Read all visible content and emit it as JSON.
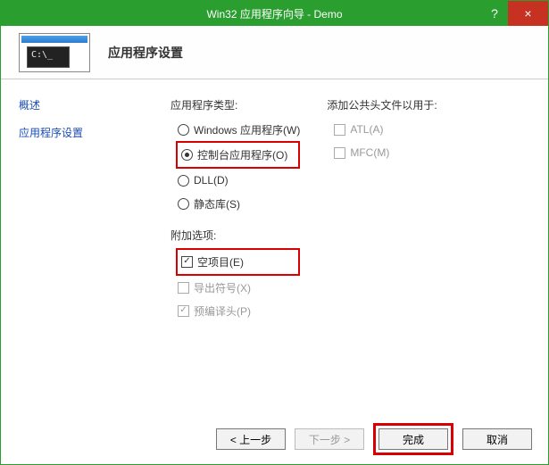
{
  "titlebar": {
    "title": "Win32 应用程序向导 - Demo",
    "help": "?",
    "close": "×"
  },
  "header": {
    "title": "应用程序设置",
    "console_text": "C:\\_"
  },
  "sidebar": {
    "items": [
      "概述",
      "应用程序设置"
    ]
  },
  "main": {
    "app_type_label": "应用程序类型:",
    "app_type": {
      "windows": "Windows 应用程序(W)",
      "console": "控制台应用程序(O)",
      "dll": "DLL(D)",
      "static": "静态库(S)"
    },
    "addl_label": "附加选项:",
    "addl": {
      "empty": "空项目(E)",
      "export": "导出符号(X)",
      "precompiled": "预编译头(P)"
    },
    "headers_label": "添加公共头文件以用于:",
    "headers": {
      "atl": "ATL(A)",
      "mfc": "MFC(M)"
    }
  },
  "footer": {
    "prev": "< 上一步",
    "next": "下一步 >",
    "finish": "完成",
    "cancel": "取消"
  }
}
